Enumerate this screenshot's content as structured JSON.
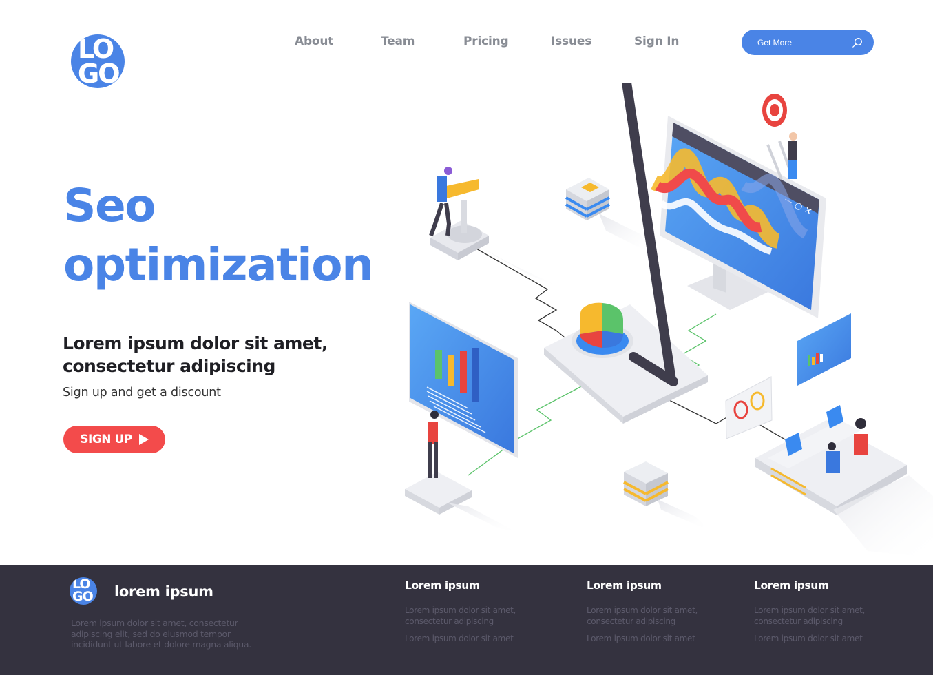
{
  "header": {
    "logo": {
      "line1": "LO",
      "line2": "GO"
    },
    "nav": [
      {
        "label": "About"
      },
      {
        "label": "Team"
      },
      {
        "label": "Pricing"
      },
      {
        "label": "Issues"
      },
      {
        "label": "Sign In"
      }
    ],
    "cta": {
      "label": "Get More",
      "icon": "search-icon"
    }
  },
  "hero": {
    "title_line1": "Seo",
    "title_line2": "optimization",
    "subtitle": "Lorem ipsum dolor sit amet, consectetur adipiscing",
    "tagline": "Sign up and get a discount",
    "signup": {
      "label": "SIGN UP",
      "icon": "play-icon"
    }
  },
  "illustration": {
    "window_controls": [
      "—",
      "○",
      "✕"
    ],
    "description": "Isometric SEO scene: monitor with wave chart, magnifier over pie chart, bar chart board, people at desks"
  },
  "footer": {
    "logo": {
      "line1": "LO",
      "line2": "GO"
    },
    "brand": "lorem ipsum",
    "description": "Lorem ipsum dolor sit amet, consectetur adipiscing elit, sed do eiusmod tempor incididunt ut labore et dolore magna aliqua.",
    "columns": [
      {
        "title": "Lorem ipsum",
        "links": [
          "Lorem ipsum dolor sit amet, consectetur adipiscing",
          "Lorem ipsum dolor sit amet"
        ]
      },
      {
        "title": "Lorem ipsum",
        "links": [
          "Lorem ipsum dolor sit amet, consectetur adipiscing",
          "Lorem ipsum dolor sit amet"
        ]
      },
      {
        "title": "Lorem ipsum",
        "links": [
          "Lorem ipsum dolor sit amet, consectetur adipiscing",
          "Lorem ipsum dolor sit amet"
        ]
      }
    ]
  },
  "colors": {
    "brand_blue": "#4a84e6",
    "cta_red": "#f34b4b",
    "footer_bg": "#34323f",
    "nav_text": "#888c94"
  }
}
